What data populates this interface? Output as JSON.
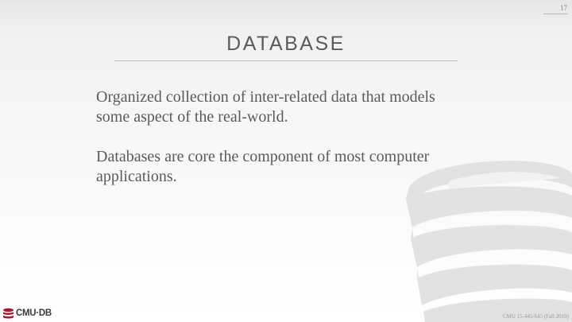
{
  "slide": {
    "number": "17",
    "title": "DATABASE",
    "paragraphs": [
      "Organized collection of inter-related data that models some aspect of the real-world.",
      "Databases are core the component of most computer applications."
    ],
    "logo_text": "CMU·DB",
    "footer": "CMU 15-445/645 (Fall 2019)"
  },
  "colors": {
    "accent": "#a6192e",
    "text": "#5a5a5a",
    "watermark": "#e2e2e2"
  },
  "icons": {
    "watermark": "database-icon",
    "logo": "cmu-db-logo-icon"
  }
}
